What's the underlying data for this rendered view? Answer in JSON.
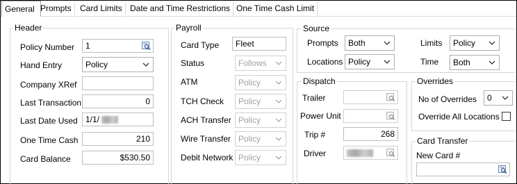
{
  "tabs": [
    {
      "label": "General",
      "active": true
    },
    {
      "label": "Prompts"
    },
    {
      "label": "Card Limits"
    },
    {
      "label": "Date and Time Restrictions"
    },
    {
      "label": "One Time Cash Limit"
    }
  ],
  "header": {
    "title": "Header",
    "policy_number_label": "Policy Number",
    "policy_number_value": "1",
    "hand_entry_label": "Hand Entry",
    "hand_entry_value": "Policy",
    "company_xref_label": "Company XRef",
    "company_xref_value": "",
    "last_transaction_label": "Last Transaction",
    "last_transaction_value": "0",
    "last_date_used_label": "Last Date Used",
    "last_date_used_value": "1/1/",
    "one_time_cash_label": "One Time Cash",
    "one_time_cash_value": "210",
    "card_balance_label": "Card Balance",
    "card_balance_value": "$530.50"
  },
  "payroll": {
    "title": "Payroll",
    "card_type_label": "Card Type",
    "card_type_value": "Fleet",
    "status_label": "Status",
    "status_value": "Follows",
    "atm_label": "ATM",
    "atm_value": "Policy",
    "tch_check_label": "TCH Check",
    "tch_check_value": "Policy",
    "ach_transfer_label": "ACH Transfer",
    "ach_transfer_value": "Policy",
    "wire_transfer_label": "Wire Transfer",
    "wire_transfer_value": "Policy",
    "debit_network_label": "Debit Network",
    "debit_network_value": "Policy"
  },
  "source": {
    "title": "Source",
    "prompts_label": "Prompts",
    "prompts_value": "Both",
    "locations_label": "Locations",
    "locations_value": "Policy",
    "limits_label": "Limits",
    "limits_value": "Policy",
    "time_label": "Time",
    "time_value": "Both"
  },
  "dispatch": {
    "title": "Dispatch",
    "trailer_label": "Trailer",
    "trailer_value": "",
    "power_unit_label": "Power Unit",
    "power_unit_value": "",
    "trip_label": "Trip #",
    "trip_value": "268",
    "driver_label": "Driver"
  },
  "overrides": {
    "title": "Overrides",
    "no_of_overrides_label": "No of Overrides",
    "no_of_overrides_value": "0",
    "override_all_locations_label": "Override All Locations",
    "override_all_locations_checked": false
  },
  "card_transfer": {
    "title": "Card Transfer",
    "new_card_label": "New Card #",
    "new_card_value": ""
  }
}
